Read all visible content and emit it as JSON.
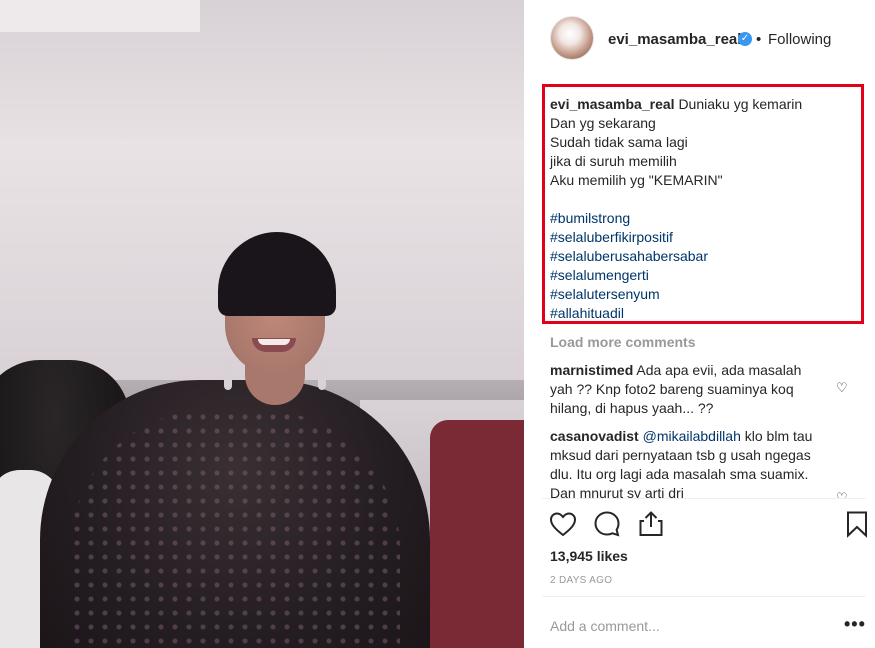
{
  "post": {
    "username": "evi_masamba_real",
    "verified_icon": "verified-badge-icon",
    "separator": "•",
    "follow_status": "Following"
  },
  "caption": {
    "username": "evi_masamba_real",
    "lines": [
      "Duniaku yg kemarin",
      "Dan yg sekarang",
      "Sudah tidak sama lagi",
      "jika di suruh memilih",
      "Aku memilih yg \"KEMARIN\""
    ],
    "hashtags": [
      "#bumilstrong",
      "#selaluberfikirpositif",
      "#selaluberusahabersabar",
      "#selalumengerti",
      "#selalutersenyum",
      "#allahituadil"
    ]
  },
  "comments": {
    "load_more": "Load more comments",
    "items": [
      {
        "username": "marnistimed",
        "text": "Ada apa evii, ada masalah yah ?? Knp foto2 bareng suaminya koq hilang, di hapus yaah... ??",
        "mention": ""
      },
      {
        "username": "casanovadist",
        "mention": "@mikailabdillah",
        "text": "klo blm tau mksud dari pernyataan tsb g usah ngegas dlu. Itu org lagi ada masalah sma suamix. Dan mnurut sy arti dri"
      }
    ]
  },
  "stats": {
    "likes": "13,945 likes",
    "time": "2 DAYS AGO"
  },
  "add_comment": {
    "placeholder": "Add a comment..."
  },
  "colors": {
    "highlight_box": "#e3001b",
    "hashtag": "#003569",
    "muted": "#999999",
    "verified": "#3897f0"
  }
}
